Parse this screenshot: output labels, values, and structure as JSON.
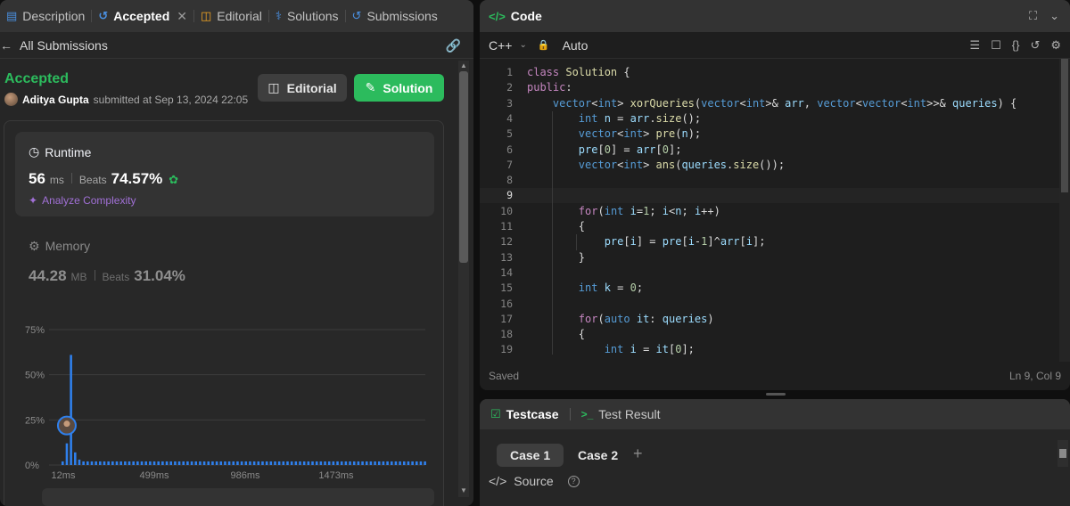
{
  "tabs": [
    {
      "label": "Description",
      "icon": "document-icon"
    },
    {
      "label": "Accepted",
      "icon": "history-icon",
      "closable": true,
      "active": true
    },
    {
      "label": "Editorial",
      "icon": "book-icon"
    },
    {
      "label": "Solutions",
      "icon": "flask-icon"
    },
    {
      "label": "Submissions",
      "icon": "history-icon"
    }
  ],
  "subbar": {
    "back_label": "All Submissions"
  },
  "submission": {
    "status": "Accepted",
    "user": "Aditya Gupta",
    "submitted_text": "submitted at Sep 13, 2024 22:05"
  },
  "buttons": {
    "editorial": "Editorial",
    "solution": "Solution"
  },
  "runtime": {
    "title": "Runtime",
    "value": "56",
    "unit": "ms",
    "beats_label": "Beats",
    "beats_value": "74.57%",
    "analyze_label": "Analyze Complexity"
  },
  "memory": {
    "title": "Memory",
    "value": "44.28",
    "unit": "MB",
    "beats_label": "Beats",
    "beats_value": "31.04%"
  },
  "chart_data": {
    "type": "bar",
    "y_ticks": [
      "75%",
      "50%",
      "25%",
      "0%"
    ],
    "ylim": [
      0,
      75
    ],
    "x_ticks": [
      "12ms",
      "499ms",
      "986ms",
      "1473ms"
    ],
    "values": [
      2,
      12,
      61,
      7,
      3,
      2,
      2,
      2,
      2,
      2,
      2,
      2,
      2,
      2,
      2,
      2,
      2,
      2,
      2,
      2,
      2,
      2,
      2,
      2,
      2,
      2,
      2,
      2,
      2,
      2,
      2,
      2,
      2,
      2,
      2,
      2,
      2,
      2,
      2,
      2,
      2,
      2,
      2,
      2,
      2,
      2,
      2,
      2,
      2,
      2,
      2,
      2,
      2,
      2,
      2,
      2,
      2,
      2,
      2,
      2,
      2,
      2,
      2,
      2,
      2,
      2,
      2,
      2,
      2,
      2,
      2,
      2,
      2,
      2,
      2,
      2,
      2,
      2,
      2,
      2,
      2,
      2,
      2,
      2,
      2,
      2,
      2,
      2
    ],
    "marker_index": 1,
    "grid": true,
    "colors": {
      "bar": "#2f80ed",
      "grid": "#3d3d3d",
      "tick": "#8a8a8a"
    }
  },
  "code_panel": {
    "title": "Code",
    "language": "C++",
    "mode": "Auto",
    "footer_status": "Saved",
    "cursor_position": "Ln 9, Col 9",
    "current_line": 9,
    "lines": [
      [
        [
          "kw",
          "class "
        ],
        [
          "fn",
          "Solution"
        ],
        [
          "",
          ""
        ],
        [
          "p",
          " {"
        ]
      ],
      [
        [
          "kw",
          "public"
        ],
        [
          "p",
          ":"
        ]
      ],
      [
        [
          "p",
          "    "
        ],
        [
          "ty",
          "vector"
        ],
        [
          "p",
          "<"
        ],
        [
          "ty",
          "int"
        ],
        [
          "p",
          "> "
        ],
        [
          "fn",
          "xorQueries"
        ],
        [
          "p",
          "("
        ],
        [
          "ty",
          "vector"
        ],
        [
          "p",
          "<"
        ],
        [
          "ty",
          "int"
        ],
        [
          "p",
          ">& "
        ],
        [
          "id",
          "arr"
        ],
        [
          "p",
          ", "
        ],
        [
          "ty",
          "vector"
        ],
        [
          "p",
          "<"
        ],
        [
          "ty",
          "vector"
        ],
        [
          "p",
          "<"
        ],
        [
          "ty",
          "int"
        ],
        [
          "p",
          ">>& "
        ],
        [
          "id",
          "queries"
        ],
        [
          "p",
          ") {"
        ]
      ],
      [
        [
          "p",
          "        "
        ],
        [
          "ty",
          "int "
        ],
        [
          "id",
          "n"
        ],
        [
          "p",
          " = "
        ],
        [
          "id",
          "arr"
        ],
        [
          "p",
          "."
        ],
        [
          "fn",
          "size"
        ],
        [
          "p",
          "();"
        ]
      ],
      [
        [
          "p",
          "        "
        ],
        [
          "ty",
          "vector"
        ],
        [
          "p",
          "<"
        ],
        [
          "ty",
          "int"
        ],
        [
          "p",
          "> "
        ],
        [
          "fn",
          "pre"
        ],
        [
          "p",
          "("
        ],
        [
          "id",
          "n"
        ],
        [
          "p",
          ");"
        ]
      ],
      [
        [
          "p",
          "        "
        ],
        [
          "id",
          "pre"
        ],
        [
          "p",
          "["
        ],
        [
          "num",
          "0"
        ],
        [
          "p",
          "] = "
        ],
        [
          "id",
          "arr"
        ],
        [
          "p",
          "["
        ],
        [
          "num",
          "0"
        ],
        [
          "p",
          "];"
        ]
      ],
      [
        [
          "p",
          "        "
        ],
        [
          "ty",
          "vector"
        ],
        [
          "p",
          "<"
        ],
        [
          "ty",
          "int"
        ],
        [
          "p",
          "> "
        ],
        [
          "fn",
          "ans"
        ],
        [
          "p",
          "("
        ],
        [
          "id",
          "queries"
        ],
        [
          "p",
          "."
        ],
        [
          "fn",
          "size"
        ],
        [
          "p",
          "());"
        ]
      ],
      [
        [
          "p",
          ""
        ]
      ],
      [
        [
          "p",
          ""
        ]
      ],
      [
        [
          "p",
          "        "
        ],
        [
          "kw",
          "for"
        ],
        [
          "p",
          "("
        ],
        [
          "ty",
          "int "
        ],
        [
          "id",
          "i"
        ],
        [
          "p",
          "="
        ],
        [
          "num",
          "1"
        ],
        [
          "p",
          "; "
        ],
        [
          "id",
          "i"
        ],
        [
          "p",
          "<"
        ],
        [
          "id",
          "n"
        ],
        [
          "p",
          "; "
        ],
        [
          "id",
          "i"
        ],
        [
          "p",
          "++)"
        ]
      ],
      [
        [
          "p",
          "        {"
        ]
      ],
      [
        [
          "p",
          "            "
        ],
        [
          "id",
          "pre"
        ],
        [
          "p",
          "["
        ],
        [
          "id",
          "i"
        ],
        [
          "p",
          "] = "
        ],
        [
          "id",
          "pre"
        ],
        [
          "p",
          "["
        ],
        [
          "id",
          "i"
        ],
        [
          "p",
          "-"
        ],
        [
          "num",
          "1"
        ],
        [
          "p",
          "]^"
        ],
        [
          "id",
          "arr"
        ],
        [
          "p",
          "["
        ],
        [
          "id",
          "i"
        ],
        [
          "p",
          "];"
        ]
      ],
      [
        [
          "p",
          "        }"
        ]
      ],
      [
        [
          "p",
          ""
        ]
      ],
      [
        [
          "p",
          "        "
        ],
        [
          "ty",
          "int "
        ],
        [
          "id",
          "k"
        ],
        [
          "p",
          " = "
        ],
        [
          "num",
          "0"
        ],
        [
          "p",
          ";"
        ]
      ],
      [
        [
          "p",
          ""
        ]
      ],
      [
        [
          "p",
          "        "
        ],
        [
          "kw",
          "for"
        ],
        [
          "p",
          "("
        ],
        [
          "ty",
          "auto "
        ],
        [
          "id",
          "it"
        ],
        [
          "p",
          ": "
        ],
        [
          "id",
          "queries"
        ],
        [
          "p",
          ")"
        ]
      ],
      [
        [
          "p",
          "        {"
        ]
      ],
      [
        [
          "p",
          "            "
        ],
        [
          "ty",
          "int "
        ],
        [
          "id",
          "i"
        ],
        [
          "p",
          " = "
        ],
        [
          "id",
          "it"
        ],
        [
          "p",
          "["
        ],
        [
          "num",
          "0"
        ],
        [
          "p",
          "];"
        ]
      ]
    ]
  },
  "testcase": {
    "tab_label": "Testcase",
    "result_label": "Test Result",
    "cases": [
      "Case 1",
      "Case 2"
    ],
    "add_symbol": "+",
    "source_label": "Source"
  }
}
